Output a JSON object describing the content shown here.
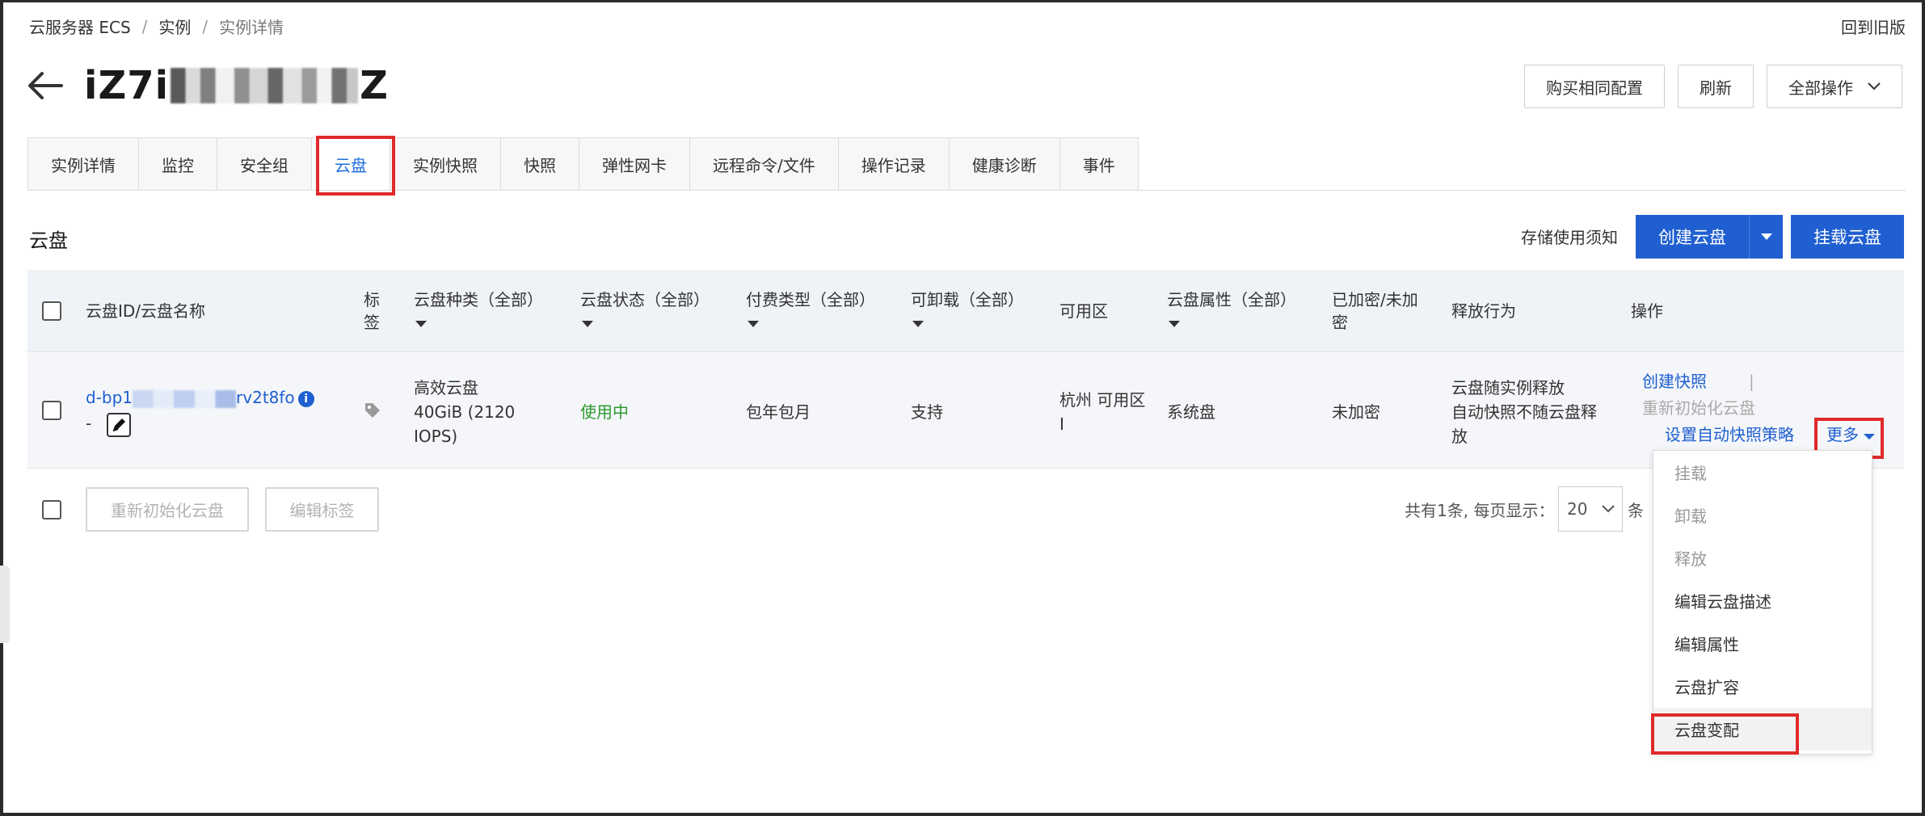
{
  "breadcrumb": {
    "root": "云服务器 ECS",
    "sep": "/",
    "instances": "实例",
    "current": "实例详情"
  },
  "old_version_link": "回到旧版",
  "instance": {
    "id_prefix": "iZ7i",
    "id_suffix": "Z"
  },
  "header_buttons": {
    "buy_same": "购买相同配置",
    "refresh": "刷新",
    "all_actions": "全部操作"
  },
  "tabs": [
    {
      "label": "实例详情"
    },
    {
      "label": "监控"
    },
    {
      "label": "安全组"
    },
    {
      "label": "云盘"
    },
    {
      "label": "实例快照"
    },
    {
      "label": "快照"
    },
    {
      "label": "弹性网卡"
    },
    {
      "label": "远程命令/文件"
    },
    {
      "label": "操作记录"
    },
    {
      "label": "健康诊断"
    },
    {
      "label": "事件"
    }
  ],
  "section": {
    "title": "云盘",
    "notice": "存储使用须知",
    "create_disk": "创建云盘",
    "attach_disk": "挂载云盘"
  },
  "table": {
    "columns": {
      "id_name": "云盘ID/云盘名称",
      "tag_1": "标",
      "tag_2": "签",
      "type": "云盘种类（全部）",
      "status": "云盘状态（全部）",
      "billing": "付费类型（全部）",
      "detachable": "可卸载（全部）",
      "zone": "可用区",
      "attribute": "云盘属性（全部）",
      "encrypted_1": "已加密/未加",
      "encrypted_2": "密",
      "release": "释放行为",
      "actions": "操作"
    },
    "rows": [
      {
        "id_prefix": "d-bp1",
        "id_suffix": "rv2t8fo",
        "name": "-",
        "type_1": "高效云盘",
        "type_2": "40GiB (2120",
        "type_3": "IOPS)",
        "status": "使用中",
        "billing": "包年包月",
        "detachable": "支持",
        "zone_1": "杭州 可用区",
        "zone_2": "I",
        "attribute": "系统盘",
        "encrypted": "未加密",
        "release_1": "云盘随实例释放",
        "release_2": "自动快照不随云盘释",
        "release_3": "放",
        "actions": {
          "create_snapshot": "创建快照",
          "divider": "|",
          "reinit": "重新初始化云盘",
          "auto_snapshot_policy": "设置自动快照策略",
          "more": "更多"
        }
      }
    ]
  },
  "footer": {
    "reinit_button": "重新初始化云盘",
    "edit_tags_button": "编辑标签",
    "pager_text": "共有1条, 每页显示：",
    "page_size": "20",
    "page_unit": "条"
  },
  "more_menu": [
    {
      "label": "挂载",
      "disabled": true
    },
    {
      "label": "卸载",
      "disabled": true
    },
    {
      "label": "释放",
      "disabled": true
    },
    {
      "label": "编辑云盘描述",
      "disabled": false
    },
    {
      "label": "编辑属性",
      "disabled": false
    },
    {
      "label": "云盘扩容",
      "disabled": false
    },
    {
      "label": "云盘变配",
      "disabled": false
    }
  ],
  "colors": {
    "primary": "#1f5fd1",
    "highlight_red": "#e02a2a",
    "status_green": "#2f9a2f"
  }
}
